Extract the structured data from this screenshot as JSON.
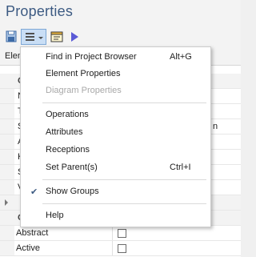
{
  "panel": {
    "title": "Properties"
  },
  "toolbar": {
    "save_icon": "floppy-disk-icon",
    "menu_icon": "hamburger-menu-icon",
    "props_icon": "element-properties-icon",
    "play_icon": "play-arrow-icon"
  },
  "tabs": {
    "fragment": "Elem"
  },
  "grid": {
    "visible_fragments": [
      "G",
      "N",
      "T",
      "S",
      "A",
      "K",
      "S",
      "V",
      "G"
    ],
    "right_fragment": "n",
    "rows": [
      {
        "label": "Abstract",
        "checked": false
      },
      {
        "label": "Active",
        "checked": false
      }
    ]
  },
  "menu": {
    "items": [
      {
        "label": "Find in Project Browser",
        "shortcut": "Alt+G",
        "enabled": true
      },
      {
        "label": "Element Properties",
        "shortcut": "",
        "enabled": true
      },
      {
        "label": "Diagram Properties",
        "shortcut": "",
        "enabled": false
      },
      {
        "label": "Operations",
        "shortcut": "",
        "enabled": true
      },
      {
        "label": "Attributes",
        "shortcut": "",
        "enabled": true
      },
      {
        "label": "Receptions",
        "shortcut": "",
        "enabled": true
      },
      {
        "label": "Set Parent(s)",
        "shortcut": "Ctrl+I",
        "enabled": true
      },
      {
        "label": "Show Groups",
        "shortcut": "",
        "enabled": true,
        "checked": true
      },
      {
        "label": "Help",
        "shortcut": "",
        "enabled": true
      }
    ]
  }
}
